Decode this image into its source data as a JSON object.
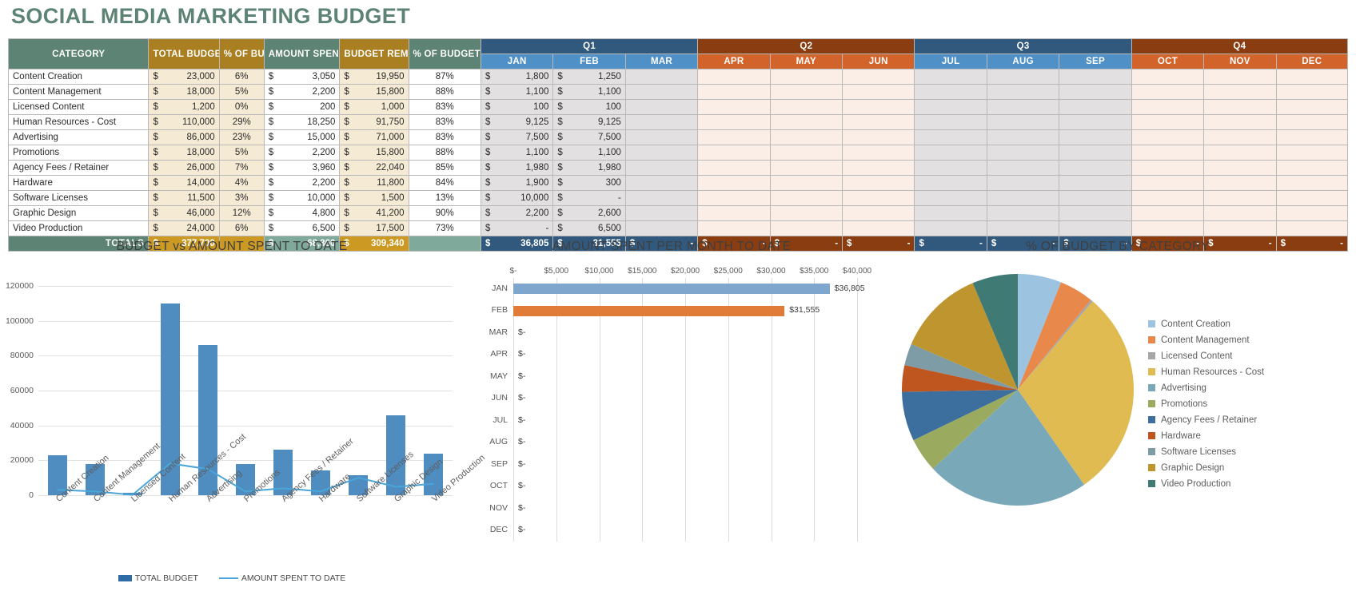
{
  "page_title": "SOCIAL MEDIA MARKETING BUDGET",
  "colors": {
    "title": "#5c8374",
    "header_teal": "#5c8374",
    "header_gold": "#a97f22",
    "q1_q3": "#31597e",
    "q2_q4": "#8a3d10",
    "month_blue": "#4f91c6",
    "month_orange": "#d2642b",
    "totals_gold": "#cc9a23"
  },
  "table": {
    "headers": {
      "category": "CATEGORY",
      "total_budget": "TOTAL BUDGET",
      "pct_of_budget": "% OF BUDGET",
      "amount_spent": "AMOUNT SPENT TO DATE",
      "budget_remaining": "BUDGET REMAINING",
      "pct_budget_remaining": "% OF BUDGET REMAINING"
    },
    "quarters": [
      {
        "label": "Q1",
        "months": [
          "JAN",
          "FEB",
          "MAR"
        ]
      },
      {
        "label": "Q2",
        "months": [
          "APR",
          "MAY",
          "JUN"
        ]
      },
      {
        "label": "Q3",
        "months": [
          "JUL",
          "AUG",
          "SEP"
        ]
      },
      {
        "label": "Q4",
        "months": [
          "OCT",
          "NOV",
          "DEC"
        ]
      }
    ],
    "currency_symbol": "$",
    "dash": "-",
    "rows": [
      {
        "category": "Content Creation",
        "total_budget": "23,000",
        "pct_of_budget": "6%",
        "amount_spent": "3,050",
        "budget_remaining": "19,950",
        "pct_remaining": "87%",
        "jan": "1,800",
        "feb": "1,250"
      },
      {
        "category": "Content Management",
        "total_budget": "18,000",
        "pct_of_budget": "5%",
        "amount_spent": "2,200",
        "budget_remaining": "15,800",
        "pct_remaining": "88%",
        "jan": "1,100",
        "feb": "1,100"
      },
      {
        "category": "Licensed Content",
        "total_budget": "1,200",
        "pct_of_budget": "0%",
        "amount_spent": "200",
        "budget_remaining": "1,000",
        "pct_remaining": "83%",
        "jan": "100",
        "feb": "100"
      },
      {
        "category": "Human Resources - Cost",
        "total_budget": "110,000",
        "pct_of_budget": "29%",
        "amount_spent": "18,250",
        "budget_remaining": "91,750",
        "pct_remaining": "83%",
        "jan": "9,125",
        "feb": "9,125"
      },
      {
        "category": "Advertising",
        "total_budget": "86,000",
        "pct_of_budget": "23%",
        "amount_spent": "15,000",
        "budget_remaining": "71,000",
        "pct_remaining": "83%",
        "jan": "7,500",
        "feb": "7,500"
      },
      {
        "category": "Promotions",
        "total_budget": "18,000",
        "pct_of_budget": "5%",
        "amount_spent": "2,200",
        "budget_remaining": "15,800",
        "pct_remaining": "88%",
        "jan": "1,100",
        "feb": "1,100"
      },
      {
        "category": "Agency Fees / Retainer",
        "total_budget": "26,000",
        "pct_of_budget": "7%",
        "amount_spent": "3,960",
        "budget_remaining": "22,040",
        "pct_remaining": "85%",
        "jan": "1,980",
        "feb": "1,980"
      },
      {
        "category": "Hardware",
        "total_budget": "14,000",
        "pct_of_budget": "4%",
        "amount_spent": "2,200",
        "budget_remaining": "11,800",
        "pct_remaining": "84%",
        "jan": "1,900",
        "feb": "300"
      },
      {
        "category": "Software Licenses",
        "total_budget": "11,500",
        "pct_of_budget": "3%",
        "amount_spent": "10,000",
        "budget_remaining": "1,500",
        "pct_remaining": "13%",
        "jan": "10,000",
        "feb": "-"
      },
      {
        "category": "Graphic Design",
        "total_budget": "46,000",
        "pct_of_budget": "12%",
        "amount_spent": "4,800",
        "budget_remaining": "41,200",
        "pct_remaining": "90%",
        "jan": "2,200",
        "feb": "2,600"
      },
      {
        "category": "Video Production",
        "total_budget": "24,000",
        "pct_of_budget": "6%",
        "amount_spent": "6,500",
        "budget_remaining": "17,500",
        "pct_remaining": "73%",
        "jan": "-",
        "feb": "6,500"
      }
    ],
    "totals": {
      "label": "TOTALS",
      "total_budget": "377,700",
      "pct_of_budget": "",
      "amount_spent": "68,360",
      "budget_remaining": "309,340",
      "pct_remaining": "",
      "jan": "36,805",
      "feb": "31,555",
      "mar": "-",
      "apr": "-",
      "may": "-",
      "jun": "-",
      "jul": "-",
      "aug": "-",
      "sep": "-",
      "oct": "-",
      "nov": "-",
      "dec": "-"
    }
  },
  "chart_data": [
    {
      "type": "bar",
      "id": "budget-vs-spent",
      "title": "BUDGET vs AMOUNT SPENT TO DATE",
      "xlabel": "",
      "ylabel": "",
      "ylim": [
        0,
        120000
      ],
      "yticks": [
        0,
        20000,
        40000,
        60000,
        80000,
        100000,
        120000
      ],
      "grid": true,
      "legend_position": "bottom",
      "categories": [
        "Content Creation",
        "Content Management",
        "Licensed Content",
        "Human Resources - Cost",
        "Advertising",
        "Promotions",
        "Agency Fees / Retainer",
        "Hardware",
        "Software Licenses",
        "Graphic Design",
        "Video Production"
      ],
      "series": [
        {
          "name": "TOTAL BUDGET",
          "type": "bar",
          "color": "#4f8cc0",
          "values": [
            23000,
            18000,
            1200,
            110000,
            86000,
            18000,
            26000,
            14000,
            11500,
            46000,
            24000
          ]
        },
        {
          "name": "AMOUNT SPENT TO DATE",
          "type": "line",
          "color": "#4aa6d8",
          "values": [
            3050,
            2200,
            200,
            18250,
            15000,
            2200,
            3960,
            2200,
            10000,
            4800,
            6500
          ]
        }
      ]
    },
    {
      "type": "bar",
      "id": "amount-spent-per-month",
      "orientation": "horizontal",
      "title": "AMOUNT SPENT PER MONTH TO DATE",
      "xlim": [
        0,
        40000
      ],
      "xticks": [
        "$-",
        "$5,000",
        "$10,000",
        "$15,000",
        "$20,000",
        "$25,000",
        "$30,000",
        "$35,000",
        "$40,000"
      ],
      "xtick_values": [
        0,
        5000,
        10000,
        15000,
        20000,
        25000,
        30000,
        35000,
        40000
      ],
      "grid": true,
      "categories": [
        "JAN",
        "FEB",
        "MAR",
        "APR",
        "MAY",
        "JUN",
        "JUL",
        "AUG",
        "SEP",
        "OCT",
        "NOV",
        "DEC"
      ],
      "values": [
        36805,
        31555,
        0,
        0,
        0,
        0,
        0,
        0,
        0,
        0,
        0,
        0
      ],
      "data_labels": [
        "$36,805",
        "$31,555",
        "$-",
        "$-",
        "$-",
        "$-",
        "$-",
        "$-",
        "$-",
        "$-",
        "$-",
        "$-"
      ],
      "colors": [
        "#7fa7cd",
        "#e07b38",
        "#a5a5a5",
        "#a5a5a5",
        "#a5a5a5",
        "#a5a5a5",
        "#a5a5a5",
        "#a5a5a5",
        "#a5a5a5",
        "#a5a5a5",
        "#a5a5a5",
        "#a5a5a5"
      ]
    },
    {
      "type": "pie",
      "id": "pct-of-budget-by-category",
      "title": "% OF BUDGET BY CATEGORY",
      "legend_position": "right",
      "labels": [
        "Content Creation",
        "Content Management",
        "Licensed Content",
        "Human Resources - Cost",
        "Advertising",
        "Promotions",
        "Agency Fees / Retainer",
        "Hardware",
        "Software Licenses",
        "Graphic Design",
        "Video Production"
      ],
      "values": [
        23000,
        18000,
        1200,
        110000,
        86000,
        18000,
        26000,
        14000,
        11500,
        46000,
        24000
      ],
      "percentages": [
        6,
        5,
        0,
        29,
        23,
        5,
        7,
        4,
        3,
        12,
        6
      ],
      "colors": [
        "#9cc3e0",
        "#e8884a",
        "#a6a6a6",
        "#e0bb52",
        "#79a9b8",
        "#9aab60",
        "#3c6e9e",
        "#bf5620",
        "#7d9ca5",
        "#bf9530",
        "#3f7a75"
      ]
    }
  ]
}
